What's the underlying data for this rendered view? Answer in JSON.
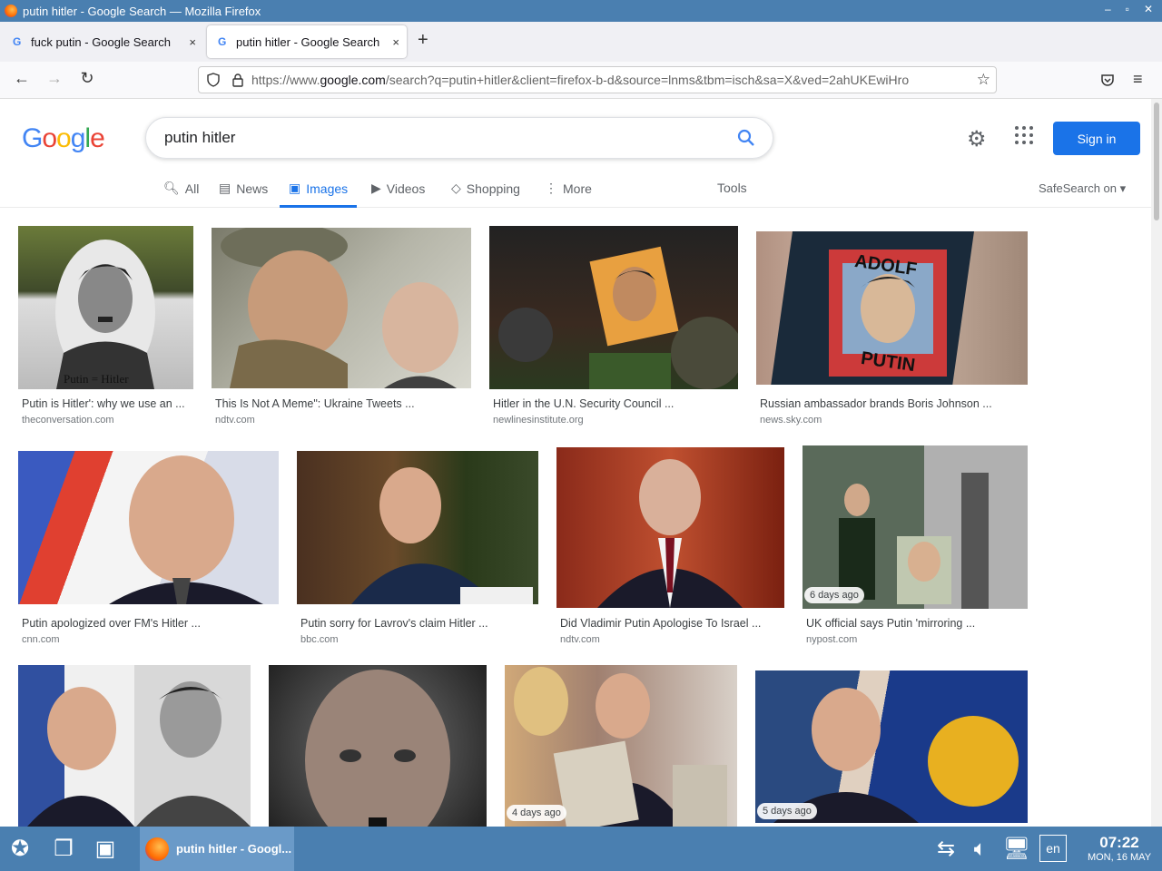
{
  "window": {
    "title": "putin hitler - Google Search — Mozilla Firefox",
    "controls": [
      "–",
      "▫",
      "✕"
    ]
  },
  "tabs": [
    {
      "label": "fuck putin - Google Search",
      "close": "×"
    },
    {
      "label": "putin hitler - Google Search",
      "close": "×"
    }
  ],
  "newtab_label": "+",
  "url": {
    "prefix": "https://www.",
    "domain": "google.com",
    "rest": "/search?q=putin+hitler&client=firefox-b-d&source=lnms&tbm=isch&sa=X&ved=2ahUKEwiHro"
  },
  "google": {
    "query": "putin hitler",
    "signin": "Sign in",
    "logo_letters": [
      "G",
      "o",
      "o",
      "g",
      "l",
      "e"
    ],
    "logo_colors": [
      "#4285f4",
      "#ea4335",
      "#fbbc05",
      "#4285f4",
      "#34a853",
      "#ea4335"
    ],
    "tabs": {
      "all": "All",
      "news": "News",
      "images": "Images",
      "videos": "Videos",
      "shopping": "Shopping",
      "more": "More",
      "tools": "Tools"
    },
    "safesearch": "SafeSearch on"
  },
  "results": [
    {
      "caption": "Putin is Hitler': why we use an ...",
      "source": "theconversation.com",
      "badge": ""
    },
    {
      "caption": "This Is Not A Meme\": Ukraine Tweets ...",
      "source": "ndtv.com",
      "badge": ""
    },
    {
      "caption": "Hitler in the U.N. Security Council ...",
      "source": "newlinesinstitute.org",
      "badge": ""
    },
    {
      "caption": "Russian ambassador brands Boris Johnson ...",
      "source": "news.sky.com",
      "badge": ""
    },
    {
      "caption": "Putin apologized over FM's Hitler ...",
      "source": "cnn.com",
      "badge": ""
    },
    {
      "caption": "Putin sorry for Lavrov's claim Hitler ...",
      "source": "bbc.com",
      "badge": ""
    },
    {
      "caption": "Did Vladimir Putin Apologise To Israel ...",
      "source": "ndtv.com",
      "badge": ""
    },
    {
      "caption": "UK official says Putin 'mirroring ...",
      "source": "nypost.com",
      "badge": "6 days ago"
    },
    {
      "caption": "",
      "source": "",
      "badge": ""
    },
    {
      "caption": "",
      "source": "",
      "badge": ""
    },
    {
      "caption": "",
      "source": "",
      "badge": "4 days ago"
    },
    {
      "caption": "",
      "source": "",
      "badge": "5 days ago"
    }
  ],
  "image_texts": {
    "r1_sign": "Putin = Hitler",
    "r4_top": "ADOLF",
    "r4_bottom": "PUTIN"
  },
  "taskbar": {
    "app_label": "putin hitler - Googl...",
    "lang": "en",
    "time": "07:22",
    "date": "MON, 16 MAY"
  }
}
